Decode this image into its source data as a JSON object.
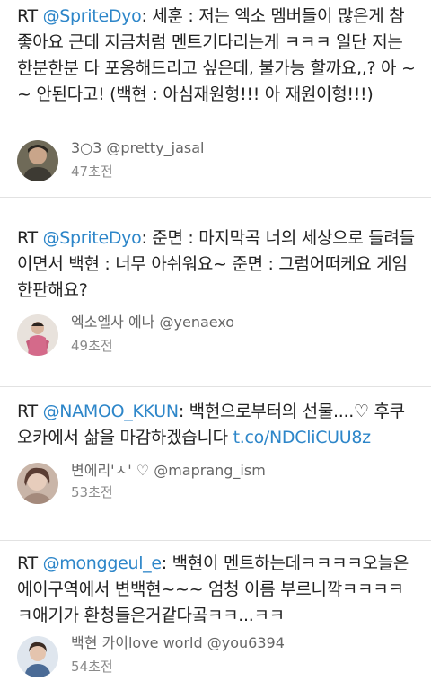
{
  "tweets": [
    {
      "rt": "RT ",
      "mention": "@SpriteDyo",
      "body": ": 세훈 : 저는 엑소 멤버들이 많은게 참 좋아요 근데 지금처럼 멘트기다리는게 ㅋㅋㅋ 일단 저는 한분한분 다 포옹해드리고 싶은데, 불가능 할까요,,? 아 ~~ 안된다고! (백현 : 아심재원형!!! 아 재원이형!!!)",
      "display_name": "3○3",
      "handle": "@pretty_jasal",
      "time": "47초전",
      "avatar": "avatar-icon"
    },
    {
      "rt": "RT ",
      "mention": "@SpriteDyo",
      "body": ": 준면 : 마지막곡 너의 세상으로 들려들이면서 백현 : 너무 아쉬워요~ 준면 : 그럼어떠케요 게임한판해요?",
      "display_name": "엑소엘사 예나",
      "handle": "@yenaexo",
      "time": "49초전",
      "avatar": "avatar-icon"
    },
    {
      "rt": "RT ",
      "mention": "@NAMOO_KKUN",
      "body": ": 백현으로부터의 선물....♡ 후쿠오카에서 삶을 마감하겠습니다 ",
      "link": "t.co/NDCliCUU8z",
      "display_name": "변에리'ㅅ' ♡",
      "handle": "@maprang_ism",
      "time": "53초전",
      "avatar": "avatar-icon"
    },
    {
      "rt": "RT ",
      "mention": "@monggeul_e",
      "body": ": 백현이 멘트하는데ㅋㅋㅋㅋ오늘은 에이구역에서 변백현~~~ 엄청 이름 부르니깍ㅋㅋㅋㅋㅋ애기가 환청들은거같다곸ㅋㅋ...ㅋㅋ",
      "display_name": "백현 카이love world",
      "handle": "@you6394",
      "time": "54초전",
      "avatar": "avatar-icon"
    }
  ],
  "colors": {
    "mention": "#2d86c9",
    "text": "#222222",
    "meta": "#666666",
    "divider": "#e2e2e2"
  }
}
